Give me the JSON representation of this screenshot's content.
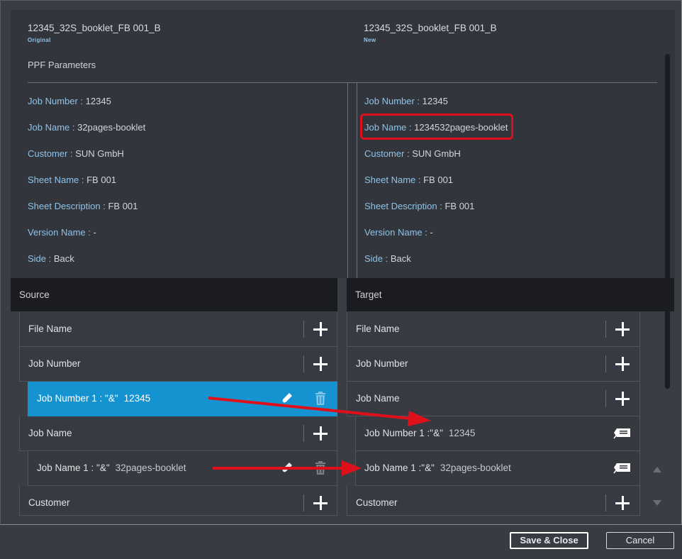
{
  "original": {
    "filename": "12345_32S_booklet_FB 001_B",
    "tag": "Original"
  },
  "new": {
    "filename": "12345_32S_booklet_FB 001_B",
    "tag": "New"
  },
  "ppf_title": "PPF Parameters",
  "left_params": [
    {
      "key": "Job Number",
      "value": "12345"
    },
    {
      "key": "Job Name",
      "value": "32pages-booklet"
    },
    {
      "key": "Customer",
      "value": "SUN GmbH"
    },
    {
      "key": "Sheet Name",
      "value": "FB 001"
    },
    {
      "key": "Sheet Description",
      "value": "FB 001"
    },
    {
      "key": "Version Name",
      "value": "-"
    },
    {
      "key": "Side",
      "value": "Back"
    }
  ],
  "right_params": [
    {
      "key": "Job Number",
      "value": "12345"
    },
    {
      "key": "Job Name",
      "value": "1234532pages-booklet"
    },
    {
      "key": "Customer",
      "value": "SUN GmbH"
    },
    {
      "key": "Sheet Name",
      "value": "FB 001"
    },
    {
      "key": "Sheet Description",
      "value": "FB 001"
    },
    {
      "key": "Version Name",
      "value": "-"
    },
    {
      "key": "Side",
      "value": "Back"
    }
  ],
  "source": {
    "label": "Source",
    "rows": [
      {
        "label": "File Name"
      },
      {
        "label": "Job Number"
      },
      {
        "label": "Job Number 1 : \"&\"",
        "value": "12345"
      },
      {
        "label": "Job Name"
      },
      {
        "label": "Job Name 1 : \"&\"",
        "value": "32pages-booklet"
      },
      {
        "label": "Customer"
      }
    ]
  },
  "target": {
    "label": "Target",
    "rows": [
      {
        "label": "File Name"
      },
      {
        "label": "Job Number"
      },
      {
        "label": "Job Name"
      },
      {
        "label": "Job Number 1 :\"&\"",
        "value": "12345"
      },
      {
        "label": "Job Name 1 :\"&\"",
        "value": "32pages-booklet"
      },
      {
        "label": "Customer"
      }
    ]
  },
  "buttons": {
    "save_close": "Save & Close",
    "cancel": "Cancel"
  },
  "colors": {
    "selected": "#1593d0",
    "highlight": "#e0101a",
    "key_text": "#8fc3e6"
  }
}
